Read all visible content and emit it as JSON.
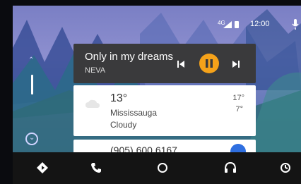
{
  "status_bar": {
    "signal_badge": "4G",
    "time": "12:00"
  },
  "media": {
    "title": "Only in my dreams",
    "artist": "NEVA"
  },
  "weather": {
    "temperature": "13°",
    "location": "Mississauga",
    "condition": "Cloudy",
    "high": "17°",
    "low": "7°"
  },
  "contact": {
    "phone": "(905) 600 6167"
  },
  "colors": {
    "accent": "#f5a21a",
    "contact_accent": "#2f6fe0"
  },
  "nav": {
    "items": [
      "navigation-icon",
      "phone-icon",
      "home-icon",
      "headphones-icon",
      "overview-icon"
    ]
  }
}
